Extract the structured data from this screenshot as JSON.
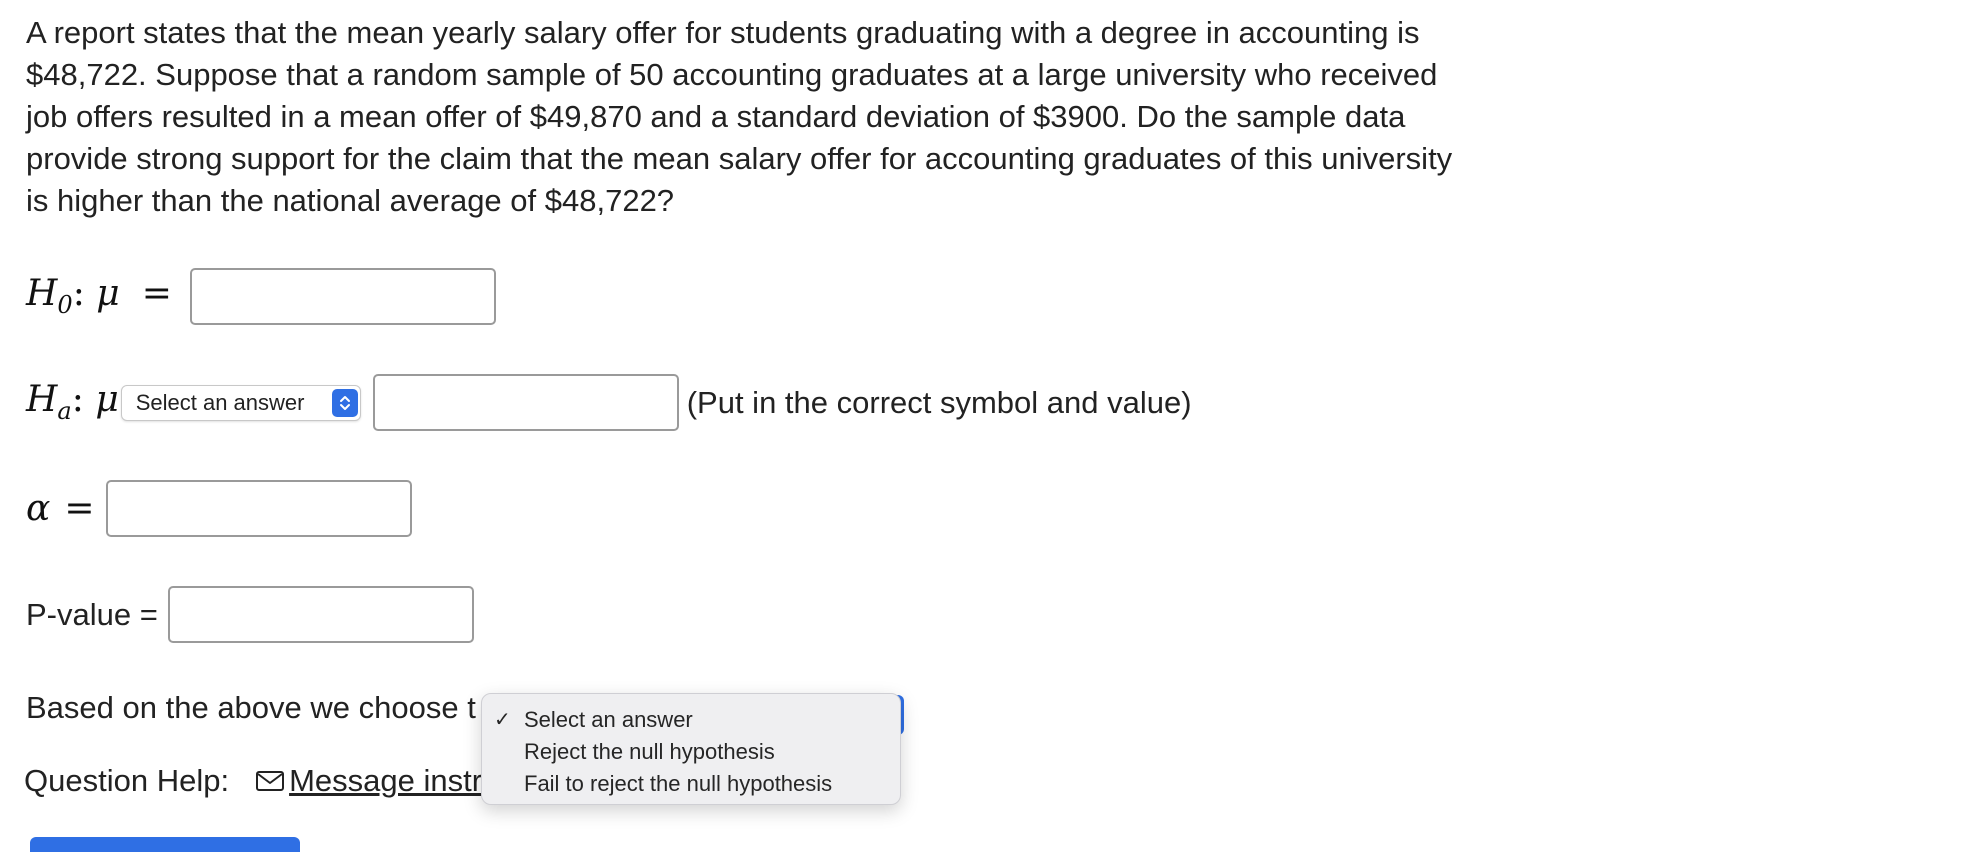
{
  "question": {
    "text": "A report states that the mean yearly salary offer for students graduating with a degree in accounting is $48,722. Suppose that a random sample of 50 accounting graduates at a large university who received job offers resulted in a mean offer of $49,870 and a standard deviation of $3900. Do the sample data provide strong support for the claim that the mean salary offer for accounting graduates of this university is higher than the national average of $48,722?"
  },
  "null_hypothesis": {
    "H": "H",
    "sub": "0",
    "mu": "μ",
    "equals": "=",
    "value": ""
  },
  "alt_hypothesis": {
    "H": "H",
    "sub": "a",
    "mu": "μ",
    "select_value": "Select an answer",
    "value": "",
    "hint": "(Put in the correct symbol and value)"
  },
  "alpha": {
    "symbol": "α",
    "equals": "=",
    "value": ""
  },
  "p_value": {
    "label": "P-value =",
    "value": ""
  },
  "decision": {
    "prefix": "Based on the above we choose t",
    "options": [
      {
        "label": "Select an answer",
        "selected": true
      },
      {
        "label": "Reject the null hypothesis",
        "selected": false
      },
      {
        "label": "Fail to reject the null hypothesis",
        "selected": false
      }
    ],
    "check_mark": "✓"
  },
  "help": {
    "label": "Question Help:",
    "link_label": "Message instru",
    "link_icon": "mail-icon"
  },
  "colors": {
    "accent": "#2f6fe4",
    "border": "#9a9a9a",
    "menu_bg": "#efeff1"
  }
}
